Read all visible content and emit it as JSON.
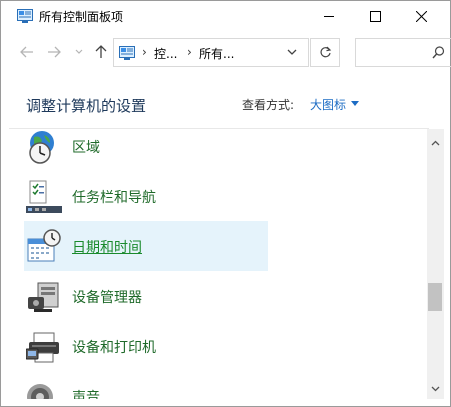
{
  "window": {
    "title": "所有控制面板项"
  },
  "address": {
    "crumbs": [
      "控...",
      "所有..."
    ]
  },
  "header": {
    "title": "调整计算机的设置",
    "view_by_label": "查看方式:",
    "view_by_value": "大图标"
  },
  "items": [
    {
      "label": "区域",
      "icon": "region-globe-clock-icon"
    },
    {
      "label": "任务栏和导航",
      "icon": "taskbar-icon"
    },
    {
      "label": "日期和时间",
      "icon": "calendar-clock-icon",
      "selected": true
    },
    {
      "label": "设备管理器",
      "icon": "device-manager-icon"
    },
    {
      "label": "设备和打印机",
      "icon": "printer-icon"
    },
    {
      "label": "声音",
      "icon": "speaker-icon"
    }
  ],
  "colors": {
    "link_text": "#1f6a2a",
    "selection_bg": "#e5f3fb",
    "view_value": "#1c6cc4"
  }
}
